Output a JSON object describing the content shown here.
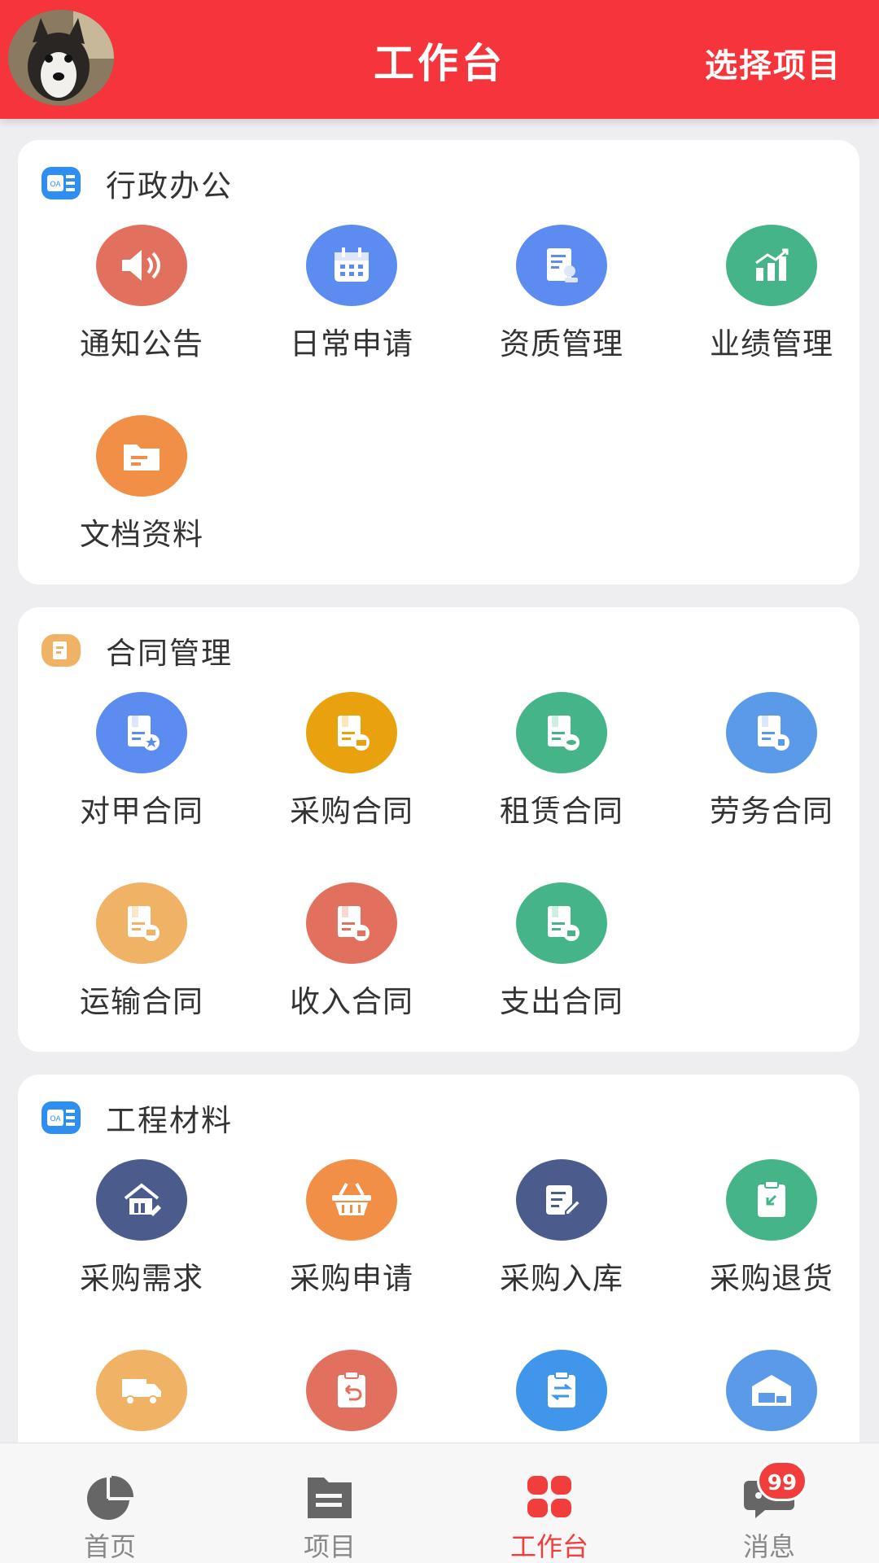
{
  "header": {
    "title": "工作台",
    "select_project": "选择项目"
  },
  "sections": {
    "admin": {
      "title": "行政办公",
      "items": [
        "通知公告",
        "日常申请",
        "资质管理",
        "业绩管理",
        "文档资料"
      ]
    },
    "contract": {
      "title": "合同管理",
      "items": [
        "对甲合同",
        "采购合同",
        "租赁合同",
        "劳务合同",
        "运输合同",
        "收入合同",
        "支出合同"
      ]
    },
    "material": {
      "title": "工程材料",
      "items": [
        "采购需求",
        "采购申请",
        "采购入库",
        "采购退货"
      ]
    }
  },
  "tabbar": {
    "home": "首页",
    "project": "项目",
    "workbench": "工作台",
    "messages": "消息",
    "messages_badge": "99"
  },
  "colors": {
    "brand_red": "#f5353b",
    "active_tab": "#f23d3d"
  }
}
